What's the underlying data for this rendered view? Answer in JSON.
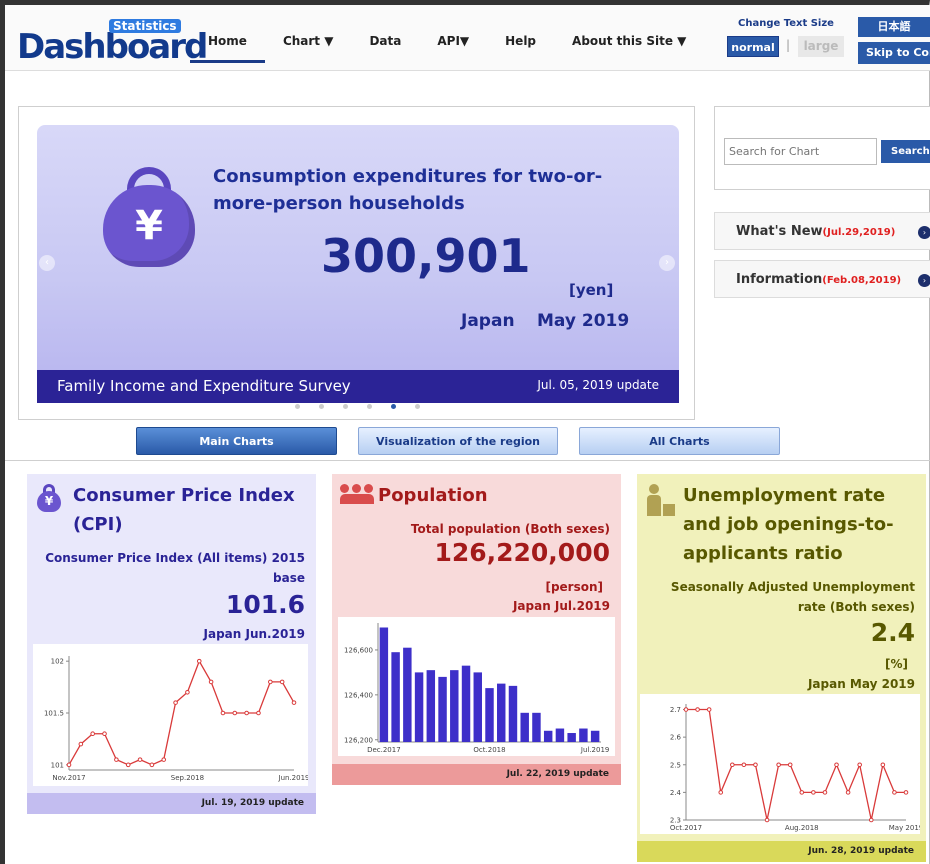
{
  "header": {
    "logo_text": "Dashboard",
    "logo_badge": "Statistics",
    "nav": [
      {
        "label": "Home"
      },
      {
        "label": "Chart ▼"
      },
      {
        "label": "Data"
      },
      {
        "label": "API▼"
      },
      {
        "label": "Help"
      },
      {
        "label": "About this Site ▼"
      }
    ],
    "text_size_label": "Change Text Size",
    "text_size_normal": "normal",
    "text_size_sep": "|",
    "text_size_large": "large",
    "lang_button": "日本語",
    "skip_button": "Skip to Content"
  },
  "carousel": {
    "title": "Consumption expenditures for two-or-more-person households",
    "value": "300,901",
    "unit": "[yen]",
    "area": "Japan",
    "date": "May 2019",
    "source": "Family Income and Expenditure Survey",
    "update": "Jul. 05, 2019 update",
    "prev_icon": "‹",
    "next_icon": "›",
    "dot_count": 6,
    "active_dot": 4
  },
  "sidebar": {
    "search_placeholder": "Search for Chart",
    "search_button": "Search",
    "whats_new_label": "What's New",
    "whats_new_date": "(Jul.29,2019)",
    "information_label": "Information",
    "information_date": "(Feb.08,2019)",
    "go_icon": "›"
  },
  "tabs": {
    "main": "Main Charts",
    "region": "Visualization of the region",
    "all": "All Charts"
  },
  "cards": {
    "cpi": {
      "title": "Consumer Price Index (CPI)",
      "subtitle": "Consumer Price Index (All items) 2015 base",
      "value": "101.6",
      "area_date": "Japan   Jun.2019",
      "footer": "Jul. 19, 2019 update",
      "accent": "#2a2396"
    },
    "population": {
      "title": "Population",
      "subtitle": "Total population (Both sexes)",
      "value": "126,220,000",
      "unit": "[person]",
      "area_date": "Japan   Jul.2019",
      "footer": "Jul. 22, 2019 update",
      "accent": "#a31a1a"
    },
    "unemployment": {
      "title": "Unemployment rate and job openings-to-applicants ratio",
      "subtitle": "Seasonally Adjusted Unemployment rate (Both sexes)",
      "value": "2.4",
      "unit": "[%]",
      "area_date": "Japan   May 2019",
      "footer": "Jun. 28, 2019 update",
      "accent": "#585800"
    }
  },
  "chart_data": [
    {
      "type": "line",
      "x_tick_labels": [
        "Nov.2017",
        "Sep.2018",
        "Jun.2019"
      ],
      "y_tick_labels": [
        "101",
        "101.5",
        "102"
      ],
      "ylim": [
        100.95,
        102.05
      ],
      "series": [
        {
          "values": [
            101.0,
            101.2,
            101.3,
            101.3,
            101.05,
            101.0,
            101.05,
            101.0,
            101.05,
            101.6,
            101.7,
            102.0,
            101.8,
            101.5,
            101.5,
            101.5,
            101.5,
            101.8,
            101.8,
            101.6
          ]
        }
      ],
      "color": "#d93a3a"
    },
    {
      "type": "bar",
      "x_tick_labels": [
        "Dec.2017",
        "Oct.2018",
        "Jul.2019"
      ],
      "y_tick_labels": [
        "126,200",
        "126,400",
        "126,600"
      ],
      "ylim": [
        126190,
        126720
      ],
      "series": [
        {
          "values": [
            126700,
            126590,
            126610,
            126500,
            126510,
            126480,
            126510,
            126530,
            126500,
            126430,
            126450,
            126440,
            126320,
            126320,
            126240,
            126250,
            126230,
            126250,
            126240
          ]
        }
      ],
      "color": "#3d2fc9"
    },
    {
      "type": "line",
      "x_tick_labels": [
        "Oct.2017",
        "Aug.2018",
        "May 2019"
      ],
      "y_tick_labels": [
        "2.3",
        "2.4",
        "2.5",
        "2.6",
        "2.7"
      ],
      "ylim": [
        2.3,
        2.72
      ],
      "series": [
        {
          "values": [
            2.7,
            2.7,
            2.7,
            2.4,
            2.5,
            2.5,
            2.5,
            2.3,
            2.5,
            2.5,
            2.4,
            2.4,
            2.4,
            2.5,
            2.4,
            2.5,
            2.3,
            2.5,
            2.4,
            2.4
          ]
        }
      ],
      "color": "#d93a3a"
    }
  ]
}
